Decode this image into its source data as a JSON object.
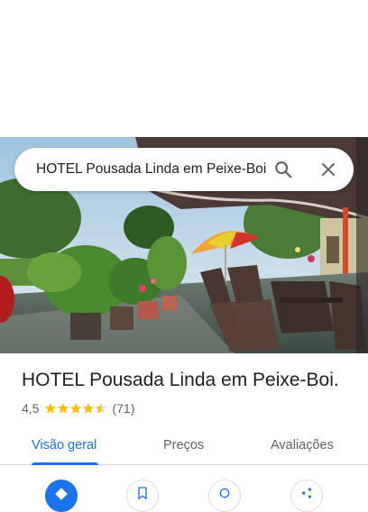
{
  "search": {
    "query": "HOTEL Pousada Linda em Peixe-Boi"
  },
  "place": {
    "title": "HOTEL Pousada Linda em Peixe-Boi.",
    "rating": "4,5",
    "rating_value": 4.5,
    "review_count": "(71)"
  },
  "tabs": [
    {
      "label": "Visão geral",
      "active": true
    },
    {
      "label": "Preços",
      "active": false
    },
    {
      "label": "Avaliações",
      "active": false
    }
  ],
  "colors": {
    "accent": "#1a73e8",
    "star": "#fbbc04"
  },
  "icons": {
    "search": "search-icon",
    "close": "close-icon",
    "star": "star-icon"
  },
  "actions": [
    {
      "icon": "directions-icon"
    },
    {
      "icon": "save-icon"
    },
    {
      "icon": "nearby-icon"
    },
    {
      "icon": "share-icon"
    }
  ]
}
